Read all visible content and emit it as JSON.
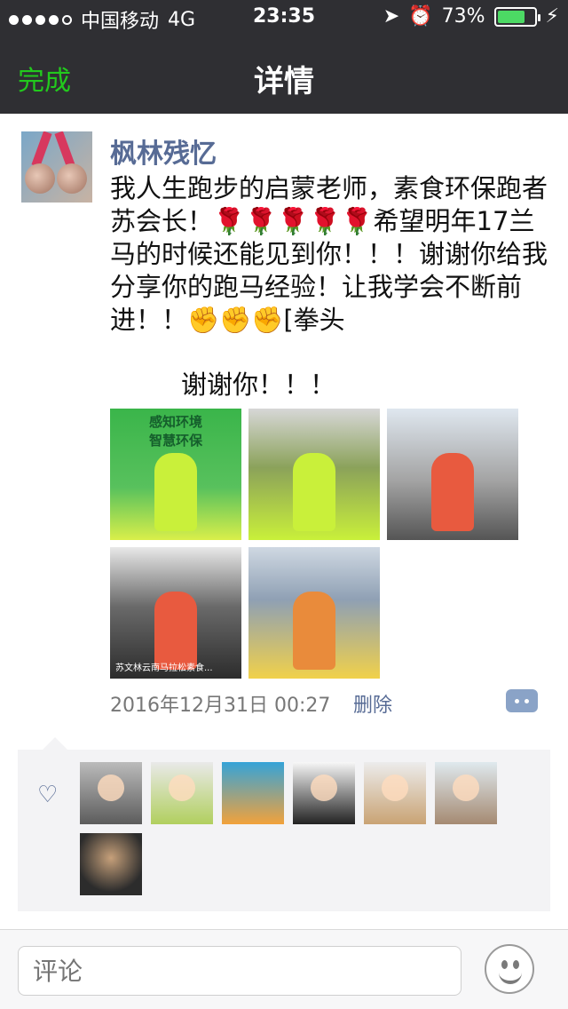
{
  "status_bar": {
    "carrier": "中国移动",
    "network": "4G",
    "time": "23:35",
    "battery_percent": "73%"
  },
  "nav": {
    "done_label": "完成",
    "title": "详情"
  },
  "post": {
    "author": "枫林残忆",
    "content": "我人生跑步的启蒙老师，素食环保跑者苏会长！🌹🌹🌹🌹🌹希望明年17兰马的时候还能见到你！！！谢谢你给我分享你的跑马经验！让我学会不断前进！！✊✊✊[拳头",
    "thanks": "谢谢你！！！",
    "photo1_caption": "感知环境\n智慧环保",
    "photo4_caption": "苏文林云南马拉松素食...",
    "timestamp": "2016年12月31日 00:27",
    "delete_label": "删除"
  },
  "bottom": {
    "comment_placeholder": "评论"
  },
  "icons": {
    "heart": "heart-icon",
    "comment": "comment-icon",
    "emoji": "emoji-icon"
  }
}
